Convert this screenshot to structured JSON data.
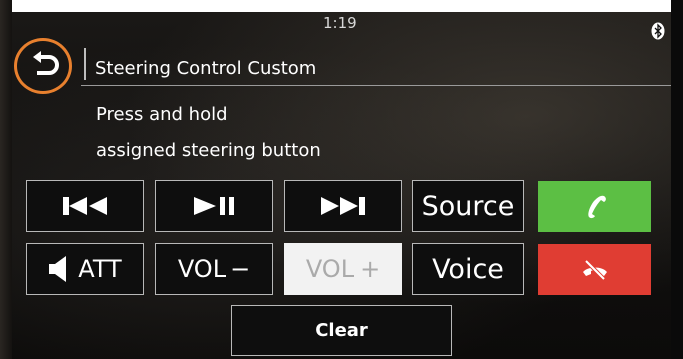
{
  "status": {
    "time": "1:19",
    "bluetooth_icon": "bluetooth-icon"
  },
  "header": {
    "title": "Steering Control Custom",
    "back_icon": "back-arrow-icon",
    "highlight_color": "#e8802e"
  },
  "instructions": {
    "line1": "Press and hold",
    "line2": "assigned steering button"
  },
  "buttons": {
    "row1": [
      {
        "icon": "previous-track-icon"
      },
      {
        "icon": "play-pause-icon"
      },
      {
        "icon": "next-track-icon"
      },
      {
        "label": "Source"
      },
      {
        "icon": "phone-answer-icon",
        "color": "#5cbf44"
      }
    ],
    "row2": [
      {
        "label": "ATT",
        "icon": "speaker-icon"
      },
      {
        "label": "VOL",
        "sign": "−"
      },
      {
        "label": "VOL",
        "sign": "+"
      },
      {
        "label": "Voice"
      },
      {
        "icon": "phone-hangup-icon",
        "color": "#e03d33"
      }
    ],
    "clear": "Clear"
  }
}
